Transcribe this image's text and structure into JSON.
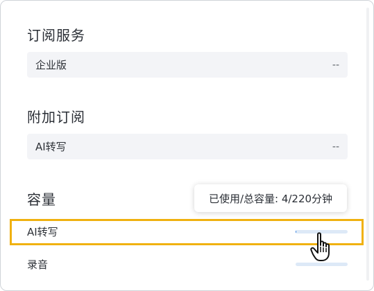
{
  "subscription": {
    "title": "订阅服务",
    "field_label": "企业版",
    "field_value": "--"
  },
  "addon": {
    "title": "附加订阅",
    "field_label": "AI转写",
    "field_value": "--"
  },
  "capacity": {
    "title": "容量",
    "tooltip": "已使用/总容量: 4/220分钟",
    "rows": [
      {
        "label": "AI转写",
        "used_fraction": 0.018
      },
      {
        "label": "录音",
        "used_fraction": 0.0
      }
    ]
  },
  "colors": {
    "highlight": "#f0b10f",
    "bar_fill": "#2f7fe0",
    "bar_track": "#dde9f7"
  },
  "icons": {
    "cursor": "hand-pointer-icon"
  }
}
